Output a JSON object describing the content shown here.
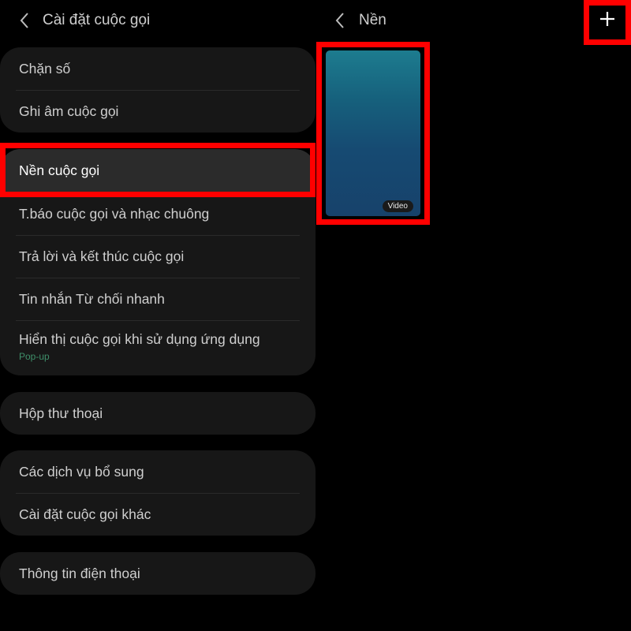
{
  "left": {
    "title": "Cài đặt cuộc gọi",
    "group1": [
      "Chặn số",
      "Ghi âm cuộc gọi"
    ],
    "group2": {
      "selected": "Nền cuộc gọi",
      "items": [
        "T.báo cuộc gọi và nhạc chuông",
        "Trả lời và kết thúc cuộc gọi",
        "Tin nhắn Từ chối nhanh"
      ],
      "popup_item": {
        "label": "Hiển thị cuộc gọi khi sử dụng ứng dụng",
        "sub": "Pop-up"
      }
    },
    "group3": [
      "Hộp thư thoại"
    ],
    "group4": [
      "Các dịch vụ bổ sung",
      "Cài đặt cuộc gọi khác"
    ],
    "group5": [
      "Thông tin điện thoại"
    ]
  },
  "right": {
    "title": "Nền",
    "thumbnail_badge": "Video"
  },
  "icons": {
    "back": "chevron-left-icon",
    "add": "plus-icon"
  },
  "colors": {
    "background": "#000000",
    "card": "#171717",
    "selected_row": "#2b2b2b",
    "highlight": "#ff0000",
    "sub_text": "#3f8f6a"
  }
}
